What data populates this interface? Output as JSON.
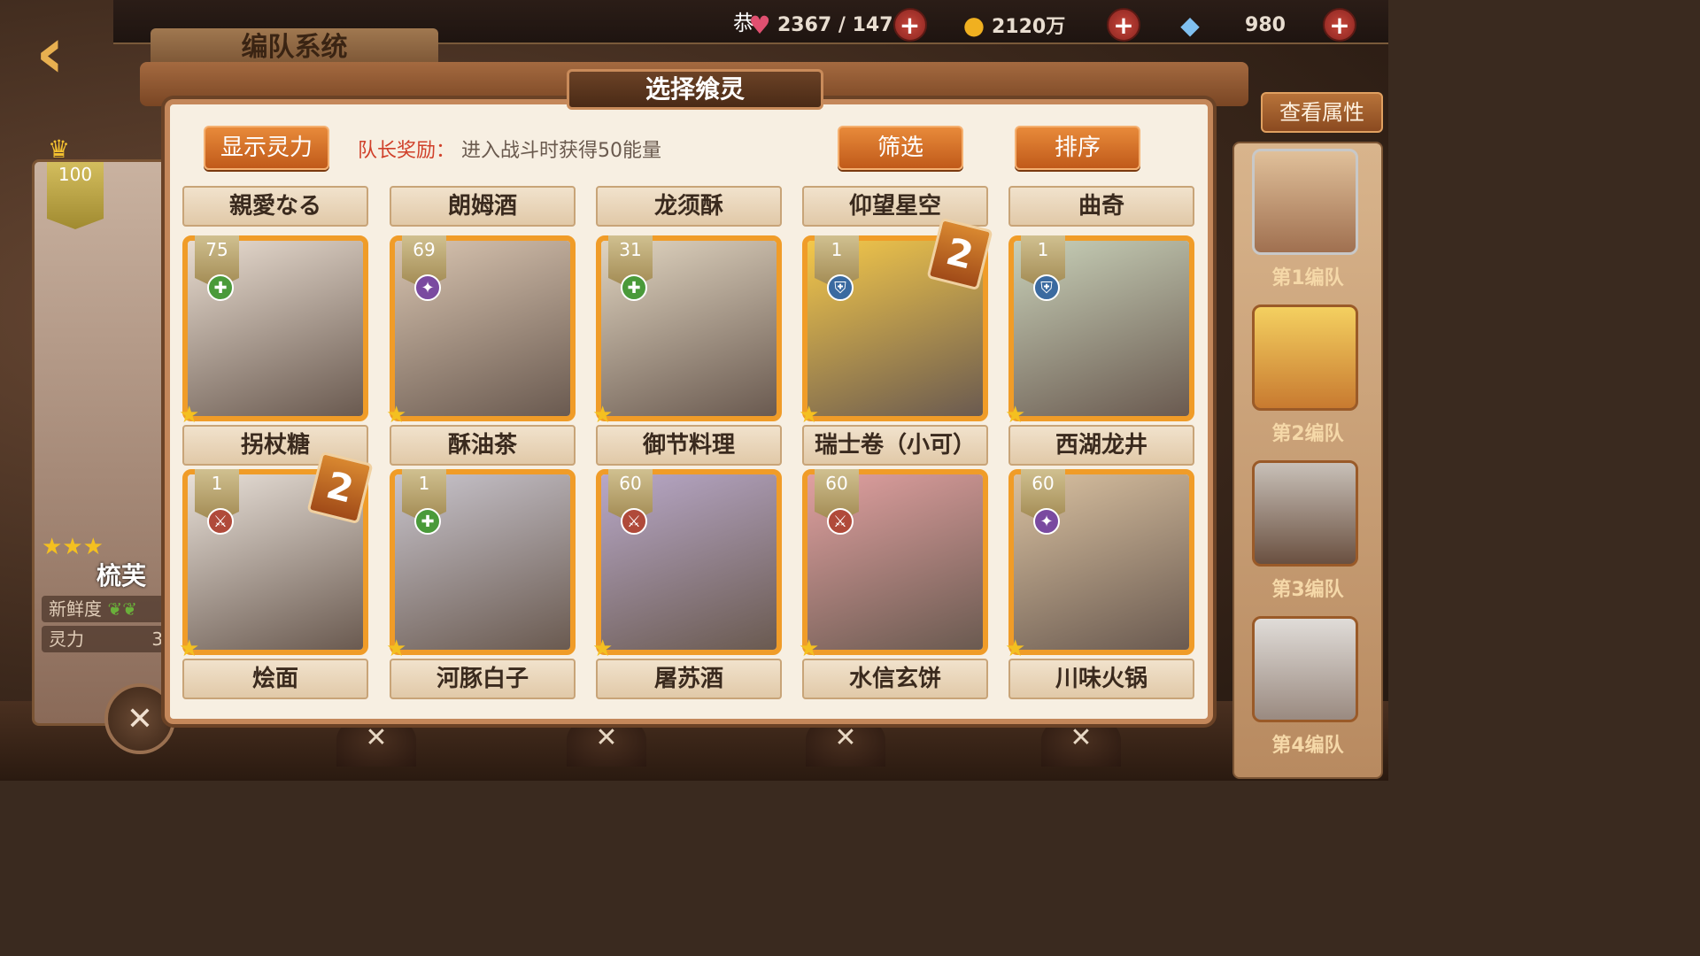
{
  "top_bar": {
    "notice": "恭",
    "stamina": "2367 / 147",
    "gold": "2120万",
    "diamonds": "980",
    "plus_symbol": "+"
  },
  "header": {
    "back_icon": "back-arrow-icon",
    "team_system_title": "编队系统",
    "view_attributes_label": "查看属性"
  },
  "dialog": {
    "title": "选择飨灵",
    "show_spirit_label": "显示灵力",
    "captain_bonus_key": "队长奖励：",
    "captain_bonus_text": "进入战斗时获得50能量",
    "filter_label": "筛选",
    "sort_label": "排序",
    "top_row_labels": [
      "親愛なる",
      "朗姆酒",
      "龙须酥",
      "仰望星空",
      "曲奇"
    ],
    "cards": [
      {
        "name": "拐杖糖",
        "level": "75",
        "role": "heal",
        "role_icon": "plus-icon",
        "count": "",
        "color": "#e8dcd0"
      },
      {
        "name": "酥油茶",
        "level": "69",
        "role": "support",
        "role_icon": "star-icon",
        "count": "",
        "color": "#d8c4b0"
      },
      {
        "name": "御节料理",
        "level": "31",
        "role": "heal",
        "role_icon": "plus-icon",
        "count": "",
        "color": "#e0d4c0"
      },
      {
        "name": "瑞士卷（小可）",
        "level": "1",
        "role": "defense",
        "role_icon": "shield-icon",
        "count": "2",
        "color": "#f4c84a"
      },
      {
        "name": "西湖龙井",
        "level": "1",
        "role": "defense",
        "role_icon": "shield-icon",
        "count": "",
        "color": "#c8d0b8"
      },
      {
        "name": "烩面",
        "level": "1",
        "role": "attack",
        "role_icon": "sword-icon",
        "count": "2",
        "color": "#e8e0d8"
      },
      {
        "name": "河豚白子",
        "level": "1",
        "role": "heal",
        "role_icon": "plus-icon",
        "count": "",
        "color": "#c8c4cc"
      },
      {
        "name": "屠苏酒",
        "level": "60",
        "role": "attack",
        "role_icon": "sword-icon",
        "count": "",
        "color": "#b8a8c8"
      },
      {
        "name": "水信玄饼",
        "level": "60",
        "role": "attack",
        "role_icon": "sword-icon",
        "count": "",
        "color": "#e0a0a0"
      },
      {
        "name": "川味火锅",
        "level": "60",
        "role": "support",
        "role_icon": "star-icon",
        "count": "",
        "color": "#d8c0a0"
      }
    ]
  },
  "leader": {
    "level": "100",
    "stars": "★★★",
    "name": "梳芙",
    "freshness_label": "新鲜度",
    "spirit_label": "灵力",
    "spirit_value": "3"
  },
  "teams": {
    "labels": [
      "第1编队",
      "第2编队",
      "第3编队",
      "第4编队"
    ]
  },
  "colors": {
    "accent_orange": "#e88a3a",
    "frame_brown": "#c4875a",
    "panel_bg": "#f7efe2"
  }
}
